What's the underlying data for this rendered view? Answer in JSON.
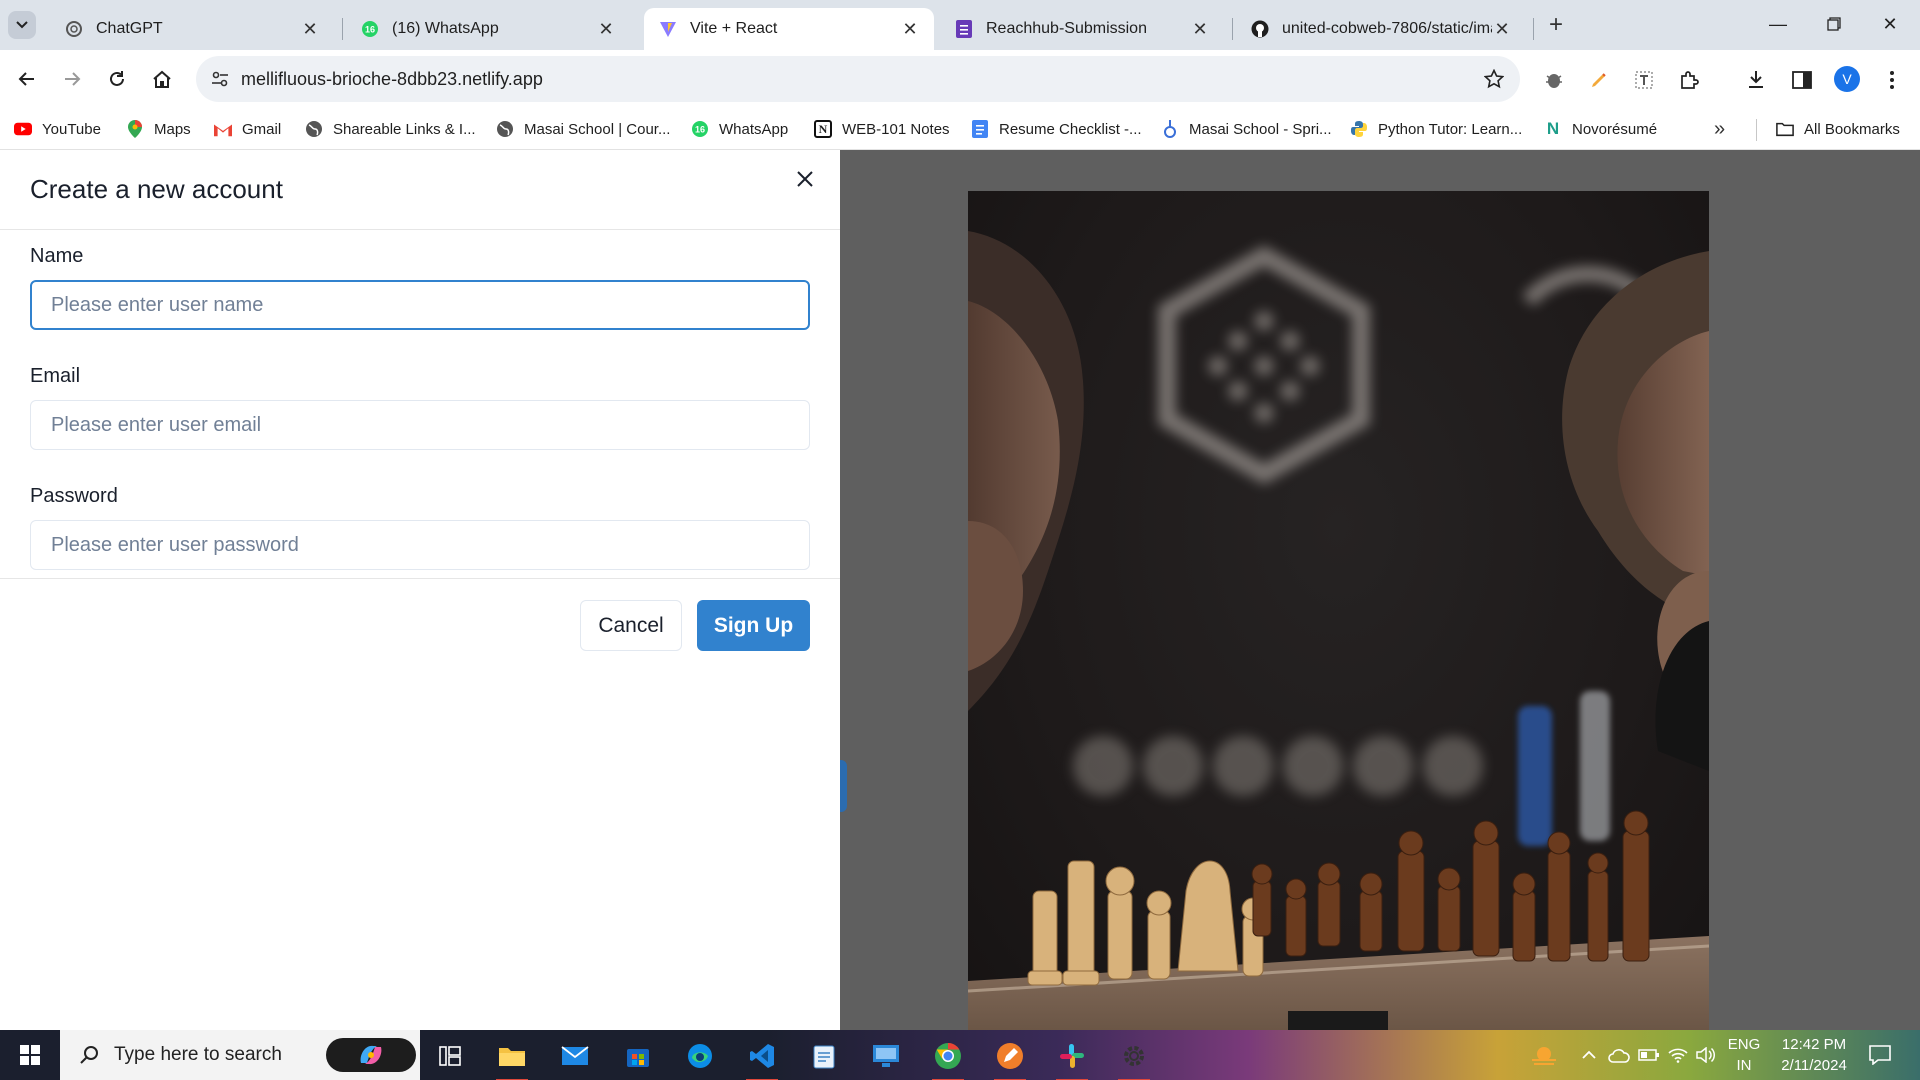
{
  "tabs": [
    {
      "label": "ChatGPT",
      "icon": "chatgpt-icon",
      "active": false
    },
    {
      "label": "(16) WhatsApp",
      "icon": "whatsapp-icon",
      "badge": "16",
      "active": false
    },
    {
      "label": "Vite + React",
      "icon": "vite-icon",
      "active": true
    },
    {
      "label": "Reachhub-Submission",
      "icon": "forms-icon",
      "active": false
    },
    {
      "label": "united-cobweb-7806/static/ima",
      "icon": "github-icon",
      "active": false
    }
  ],
  "omnibox": {
    "url": "mellifluous-brioche-8dbb23.netlify.app"
  },
  "profile": {
    "initial": "V"
  },
  "bookmarks": [
    {
      "label": "YouTube",
      "icon": "youtube-icon"
    },
    {
      "label": "Maps",
      "icon": "maps-icon"
    },
    {
      "label": "Gmail",
      "icon": "gmail-icon"
    },
    {
      "label": "Shareable Links & I...",
      "icon": "globe-icon"
    },
    {
      "label": "Masai School | Cour...",
      "icon": "globe-icon"
    },
    {
      "label": "WhatsApp",
      "icon": "whatsapp-icon",
      "badge": "16"
    },
    {
      "label": "WEB-101 Notes",
      "icon": "notion-icon",
      "letter": "N"
    },
    {
      "label": "Resume Checklist -...",
      "icon": "docs-icon"
    },
    {
      "label": "Masai School - Spri...",
      "icon": "masai-icon"
    },
    {
      "label": "Python Tutor: Learn...",
      "icon": "python-icon"
    },
    {
      "label": "Novorésumé",
      "icon": "novoresume-icon",
      "letter": "N"
    }
  ],
  "all_bookmarks": "All Bookmarks",
  "form": {
    "title": "Create a new account",
    "name_label": "Name",
    "name_placeholder": "Please enter user name",
    "email_label": "Email",
    "email_placeholder": "Please enter user email",
    "password_label": "Password",
    "password_placeholder": "Please enter user password",
    "cancel_label": "Cancel",
    "signup_label": "Sign Up"
  },
  "taskbar": {
    "search_placeholder": "Type here to search",
    "lang_top": "ENG",
    "lang_bottom": "IN",
    "time": "12:42 PM",
    "date": "2/11/2024"
  },
  "colors": {
    "primary_button": "#3182ce",
    "focus_border": "#3182ce",
    "tab_strip": "#dde3ea",
    "overlay": "#5f5f5f"
  }
}
